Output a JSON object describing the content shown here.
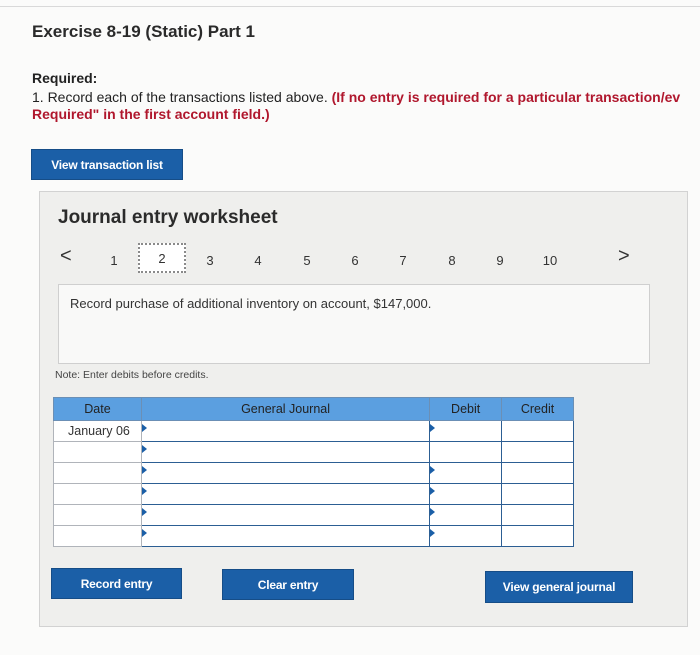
{
  "header": {
    "title": "Exercise 8-19 (Static) Part 1"
  },
  "required": {
    "heading": "Required:",
    "line1_plain": "1. Record each of the transactions listed above.",
    "line1_emph": "(If no entry is required for a particular transaction/ev",
    "line2_emph": "Required\" in the first account field.)"
  },
  "buttons": {
    "view_transactions": "View transaction list",
    "record_entry": "Record entry",
    "clear_entry": "Clear entry",
    "view_journal": "View general journal"
  },
  "worksheet": {
    "title": "Journal entry worksheet",
    "nav": {
      "prev": "<",
      "next": ">",
      "pages": [
        "1",
        "2",
        "3",
        "4",
        "5",
        "6",
        "7",
        "8",
        "9",
        "10"
      ],
      "selected": "2"
    },
    "description": "Record purchase of additional inventory on account, $147,000.",
    "note": "Note: Enter debits before credits."
  },
  "journal_table": {
    "headers": [
      "Date",
      "General Journal",
      "Debit",
      "Credit"
    ],
    "rows": [
      {
        "date": "January 06"
      },
      {
        "date": ""
      },
      {
        "date": ""
      },
      {
        "date": ""
      },
      {
        "date": ""
      },
      {
        "date": ""
      }
    ]
  },
  "colors": {
    "button_blue": "#1b5fa7",
    "header_blue": "#5b9fe0",
    "required_red": "#b0172d"
  }
}
